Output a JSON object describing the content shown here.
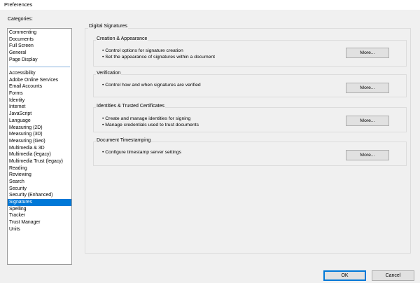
{
  "window": {
    "title": "Preferences"
  },
  "categories": {
    "label": "Categories:",
    "top_items": [
      "Commenting",
      "Documents",
      "Full Screen",
      "General",
      "Page Display"
    ],
    "items": [
      "Accessibility",
      "Adobe Online Services",
      "Email Accounts",
      "Forms",
      "Identity",
      "Internet",
      "JavaScript",
      "Language",
      "Measuring (2D)",
      "Measuring (3D)",
      "Measuring (Geo)",
      "Multimedia & 3D",
      "Multimedia (legacy)",
      "Multimedia Trust (legacy)",
      "Reading",
      "Reviewing",
      "Search",
      "Security",
      "Security (Enhanced)",
      "Signatures",
      "Spelling",
      "Tracker",
      "Trust Manager",
      "Units"
    ],
    "selected": "Signatures"
  },
  "panel": {
    "title": "Digital Signatures",
    "sections": [
      {
        "title": "Creation & Appearance",
        "bullets": [
          "• Control options for signature creation",
          "• Set the appearance of signatures within a document"
        ],
        "button": "More..."
      },
      {
        "title": "Verification",
        "bullets": [
          "• Control how and when signatures are verified"
        ],
        "button": "More..."
      },
      {
        "title": "Identities & Trusted Certificates",
        "bullets": [
          "• Create and manage identities for signing",
          "• Manage credentials used to trust documents"
        ],
        "button": "More..."
      },
      {
        "title": "Document Timestamping",
        "bullets": [
          "• Configure timestamp server settings"
        ],
        "button": "More..."
      }
    ]
  },
  "footer": {
    "ok_label": "OK",
    "cancel_label": "Cancel"
  }
}
